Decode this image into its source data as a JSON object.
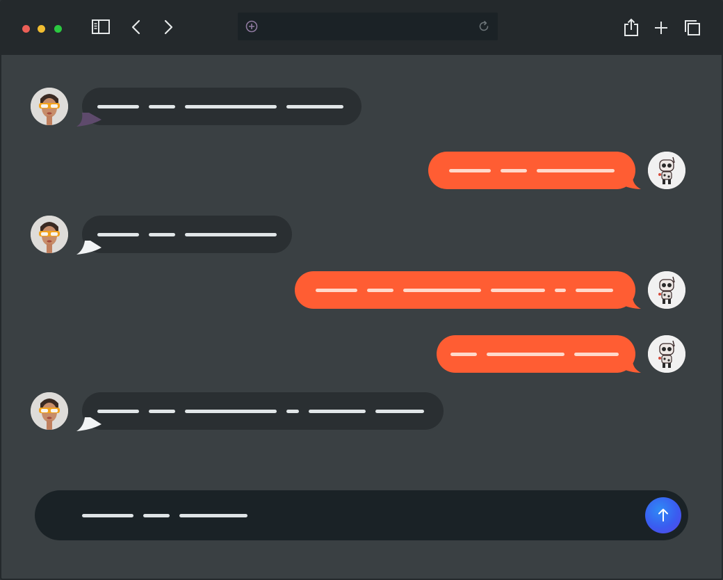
{
  "toolbar": {
    "traffic_lights": [
      {
        "name": "close",
        "color": "#ec5f57"
      },
      {
        "name": "minimize",
        "color": "#f1bd31"
      },
      {
        "name": "maximize",
        "color": "#2bc840"
      }
    ],
    "icons": [
      "sidebar-icon",
      "back-chevron-icon",
      "forward-chevron-icon",
      "share-icon",
      "new-tab-plus-icon",
      "tabs-overview-icon"
    ],
    "address_bar": {
      "icon": "add-circle-icon",
      "reload_icon": "reload-icon",
      "value": ""
    }
  },
  "chat": {
    "colors": {
      "incoming": "#2a2f32",
      "outgoing": "#ff5d33",
      "send": "#3a5cf0"
    },
    "messages": [
      {
        "sender": "user",
        "avatar": "woman-with-sunglasses",
        "text_segments": 4
      },
      {
        "sender": "bot",
        "avatar": "robot",
        "text_segments": 3
      },
      {
        "sender": "user",
        "avatar": "woman-with-sunglasses",
        "text_segments": 3
      },
      {
        "sender": "bot",
        "avatar": "robot",
        "text_segments": 6
      },
      {
        "sender": "bot",
        "avatar": "robot",
        "text_segments": 3
      },
      {
        "sender": "user",
        "avatar": "woman-with-sunglasses",
        "text_segments": 6
      }
    ]
  },
  "composer": {
    "draft_segments": 3,
    "send_icon": "arrow-up-icon"
  }
}
